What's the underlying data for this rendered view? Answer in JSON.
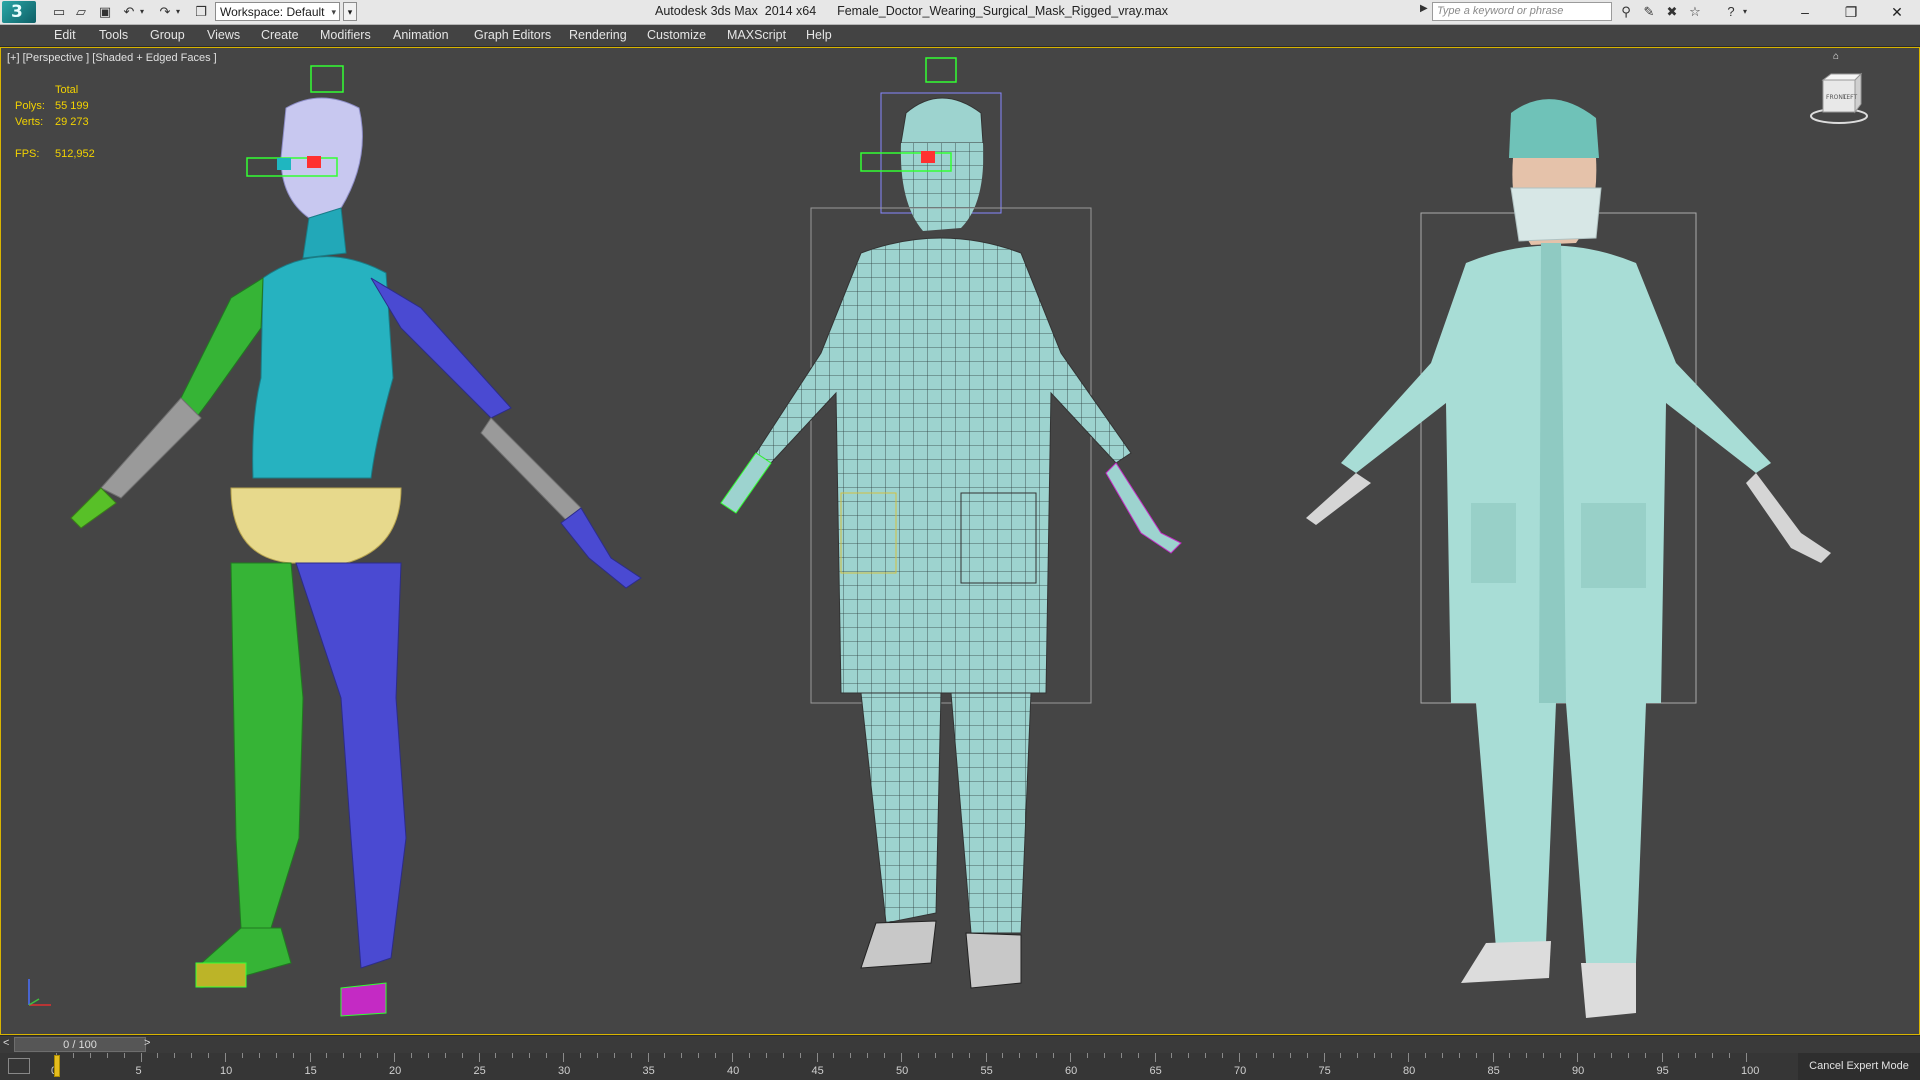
{
  "titlebar": {
    "workspace_label": "Workspace: Default",
    "app_name": "Autodesk 3ds Max  2014 x64",
    "file_name": "Female_Doctor_Wearing_Surgical_Mask_Rigged_vray.max",
    "search_placeholder": "Type a keyword or phrase"
  },
  "menu": [
    "Edit",
    "Tools",
    "Group",
    "Views",
    "Create",
    "Modifiers",
    "Animation",
    "Graph Editors",
    "Rendering",
    "Customize",
    "MAXScript",
    "Help"
  ],
  "viewport": {
    "label": "[+] [Perspective ] [Shaded + Edged Faces ]",
    "stats": {
      "total_label": "Total",
      "polys_label": "Polys:",
      "polys_value": "55 199",
      "verts_label": "Verts:",
      "verts_value": "29 273",
      "fps_label": "FPS:",
      "fps_value": "512,952"
    },
    "viewcube_labels": [
      "FRONT",
      "LEFT"
    ]
  },
  "timeline": {
    "frame_display": "0 / 100",
    "ticks": [
      "0",
      "5",
      "10",
      "15",
      "20",
      "25",
      "30",
      "35",
      "40",
      "45",
      "50",
      "55",
      "60",
      "65",
      "70",
      "75",
      "80",
      "85",
      "90",
      "95",
      "100"
    ],
    "current_frame": 0,
    "total_frames": 100
  },
  "status": {
    "cancel_expert": "Cancel Expert Mode"
  },
  "colors": {
    "accent_yellow": "#d8b400",
    "skin_cyan": "#2fb8c4",
    "limb_green": "#36b436",
    "limb_blue": "#4a4ad2",
    "scrubs": "#9fd8d0"
  }
}
